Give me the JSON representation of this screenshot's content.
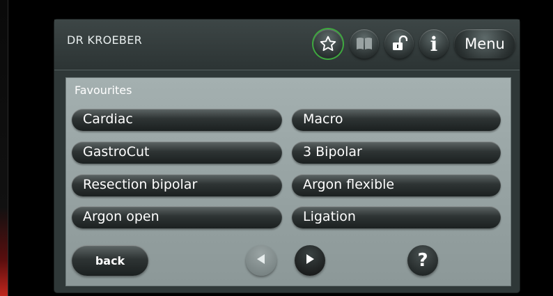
{
  "header": {
    "user_name": "DR KROEBER",
    "buttons": {
      "favourites_icon": "star-icon",
      "book_icon": "book-icon",
      "lock_icon": "lock-icon",
      "info_label": "i",
      "menu_label": "Menu"
    },
    "active_color": "#3ea83e"
  },
  "panel": {
    "title": "Favourites",
    "programs": [
      [
        "Cardiac",
        "Macro"
      ],
      [
        "GastroCut",
        "3 Bipolar"
      ],
      [
        "Resection bipolar",
        "Argon flexible"
      ],
      [
        "Argon open",
        "Ligation"
      ]
    ],
    "footer": {
      "back_label": "back",
      "prev_icon": "triangle-left-icon",
      "next_icon": "triangle-right-icon",
      "help_label": "?"
    }
  }
}
